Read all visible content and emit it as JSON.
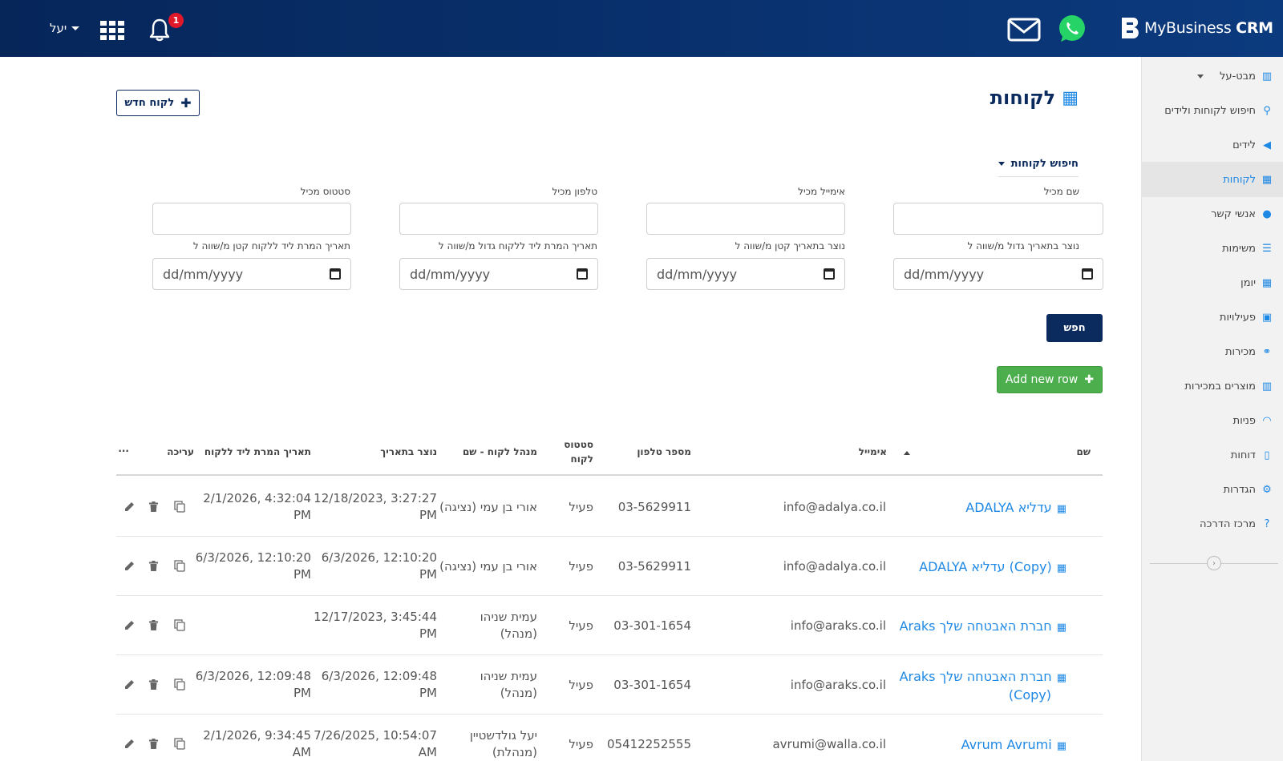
{
  "topbar": {
    "user_label": "יעל",
    "notification_count": "1",
    "brand_name_regular": "MyBusiness",
    "brand_name_bold": "CRM"
  },
  "sidebar": {
    "items": [
      {
        "label": "מבט-על",
        "icon": "bar-chart-icon"
      },
      {
        "label": "חיפוש לקוחות ולידים",
        "icon": "search-icon"
      },
      {
        "label": "לידים",
        "icon": "megaphone-icon"
      },
      {
        "label": "לקוחות",
        "icon": "building-icon"
      },
      {
        "label": "אנשי קשר",
        "icon": "user-icon"
      },
      {
        "label": "משימות",
        "icon": "list-icon"
      },
      {
        "label": "יומן",
        "icon": "calendar-icon"
      },
      {
        "label": "פעילויות",
        "icon": "calendar-check-icon"
      },
      {
        "label": "מכירות",
        "icon": "handshake-icon"
      },
      {
        "label": "מוצרים במכירות",
        "icon": "barcode-icon"
      },
      {
        "label": "פניות",
        "icon": "headset-icon"
      },
      {
        "label": "דוחות",
        "icon": "file-icon"
      },
      {
        "label": "הגדרות",
        "icon": "gear-icon"
      },
      {
        "label": "מרכז הדרכה",
        "icon": "question-icon"
      }
    ],
    "active_item": "לקוחות"
  },
  "page": {
    "title": "לקוחות",
    "new_button": "לקוח חדש"
  },
  "search": {
    "toggle_label": "חיפוש לקוחות",
    "fields": {
      "name_label": "שם מכיל",
      "email_label": "אימייל מכיל",
      "phone_label": "טלפון מכיל",
      "status_label": "סטטוס מכיל",
      "created_after_label": "נוצר בתאריך גדול מ/שווה ל",
      "created_before_label": "נוצר בתאריך קטן מ/שווה ל",
      "converted_after_label": "תאריך המרת ליד ללקוח גדול מ/שווה ל",
      "converted_before_label": "תאריך המרת ליד ללקוח קטן מ/שווה ל",
      "date_placeholder": "dd/mm/yyyy"
    },
    "search_button": "חפש"
  },
  "table": {
    "add_row_button": "Add new row",
    "headers": {
      "name": "שם",
      "email": "אימייל",
      "phone": "מספר טלפון",
      "status_line1": "סטטוס",
      "status_line2": "לקוח",
      "manager": "מנהל לקוח - שם",
      "created": "נוצר בתאריך",
      "converted": "תאריך המרת ליד ללקוח",
      "edit": "עריכה",
      "more": "..."
    },
    "rows": [
      {
        "name": "ADALYA עדליא",
        "name2": "",
        "email": "info@adalya.co.il",
        "phone": "03-5629911",
        "status": "פעיל",
        "manager1": "אורי בן עמי (נציגה)",
        "manager2": "",
        "created1": "12/18/2023, 3:27:27",
        "created2": "PM",
        "converted1": "2/1/2026, 4:32:04",
        "converted2": "PM"
      },
      {
        "name": "ADALYA עדליא (Copy)",
        "name2": "",
        "email": "info@adalya.co.il",
        "phone": "03-5629911",
        "status": "פעיל",
        "manager1": "אורי בן עמי (נציגה)",
        "manager2": "",
        "created1": "6/3/2026, 12:10:20",
        "created2": "PM",
        "converted1": "6/3/2026, 12:10:20",
        "converted2": "PM"
      },
      {
        "name": "Araks חברת האבטחה שלך",
        "name2": "",
        "email": "info@araks.co.il",
        "phone": "03-301-1654",
        "status": "פעיל",
        "manager1": "עמית שניהו",
        "manager2": "(מנהל)",
        "created1": "12/17/2023, 3:45:44",
        "created2": "PM",
        "converted1": "",
        "converted2": ""
      },
      {
        "name": "Araks חברת האבטחה שלך",
        "name2": "(Copy)",
        "email": "info@araks.co.il",
        "phone": "03-301-1654",
        "status": "פעיל",
        "manager1": "עמית שניהו",
        "manager2": "(מנהל)",
        "created1": "6/3/2026, 12:09:48",
        "created2": "PM",
        "converted1": "6/3/2026, 12:09:48",
        "converted2": "PM"
      },
      {
        "name": "Avrum Avrumi",
        "name2": "",
        "email": "avrumi@walla.co.il",
        "phone": "05412252555",
        "status": "פעיל",
        "manager1": "יעל גולדשטיין",
        "manager2": "(מנהלת)",
        "created1": "7/26/2025, 10:54:07",
        "created2": "AM",
        "converted1": "2/1/2026, 9:34:45",
        "converted2": "AM"
      }
    ]
  },
  "colors": {
    "topbar": "#0b3a7e",
    "primary": "#0b2a5e",
    "link": "#1e88e5",
    "success": "#4cae4c",
    "badge": "#e0182a"
  }
}
